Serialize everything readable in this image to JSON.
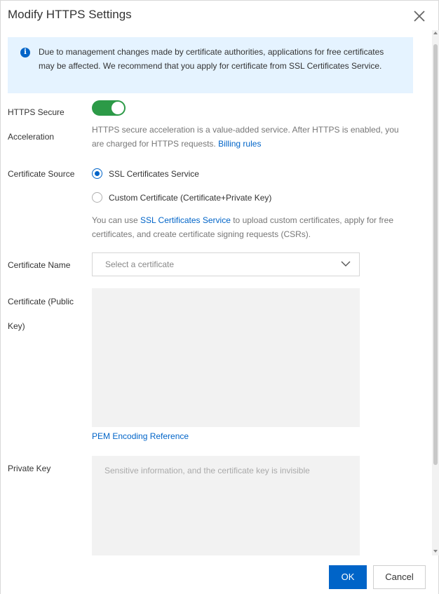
{
  "dialog": {
    "title": "Modify HTTPS Settings"
  },
  "notice": {
    "text": "Due to management changes made by certificate authorities, applications for free certificates may be affected. We recommend that you apply for certificate from SSL Certificates Service."
  },
  "https": {
    "label_line1": "HTTPS Secure",
    "label_line2": "Acceleration",
    "enabled": true,
    "help_text": "HTTPS secure acceleration is a value-added service. After HTTPS is enabled, you are charged for HTTPS requests. ",
    "billing_link": "Billing rules"
  },
  "certificate_source": {
    "label": "Certificate Source",
    "options": [
      {
        "label": "SSL Certificates Service",
        "selected": true
      },
      {
        "label": "Custom Certificate (Certificate+Private Key)",
        "selected": false
      }
    ],
    "help_prefix": "You can use ",
    "help_link": "SSL Certificates Service",
    "help_suffix": " to upload custom certificates, apply for free certificates, and create certificate signing requests (CSRs)."
  },
  "certificate_name": {
    "label": "Certificate Name",
    "placeholder": "Select a certificate"
  },
  "public_key": {
    "label_line1": "Certificate (Public",
    "label_line2": "Key)",
    "reference_link": "PEM Encoding Reference"
  },
  "private_key": {
    "label": "Private Key",
    "placeholder": "Sensitive information, and the certificate key is invisible"
  },
  "footer": {
    "ok_label": "OK",
    "cancel_label": "Cancel"
  },
  "colors": {
    "accent": "#0064c8",
    "switch_on": "#2c9a47",
    "notice_bg": "#e5f3ff"
  }
}
